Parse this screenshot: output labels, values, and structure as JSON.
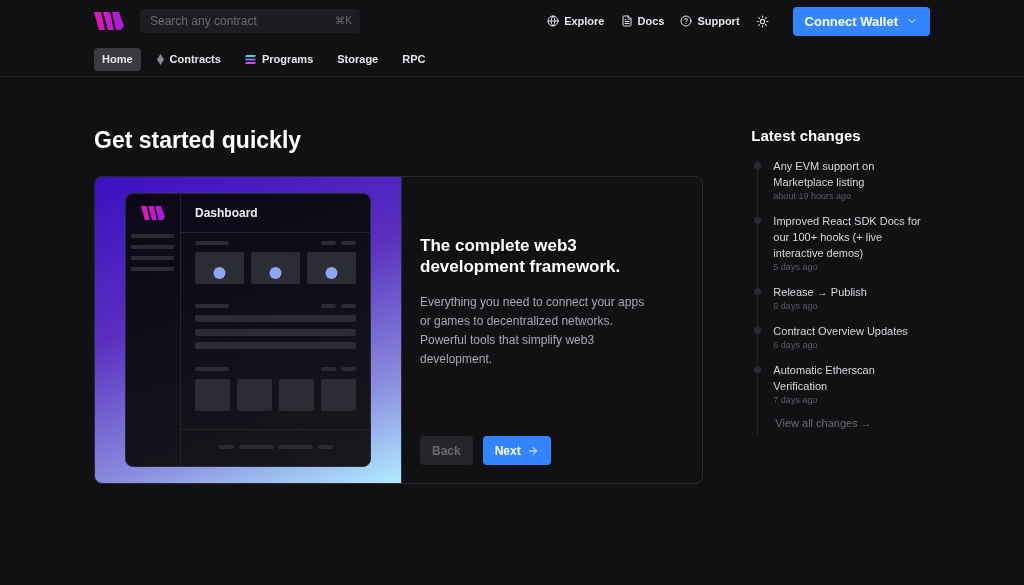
{
  "search": {
    "placeholder": "Search any contract",
    "shortcut": "⌘K"
  },
  "header_links": [
    {
      "kind": "globe",
      "label": "Explore"
    },
    {
      "kind": "doc",
      "label": "Docs"
    },
    {
      "kind": "help",
      "label": "Support"
    }
  ],
  "connect_button": "Connect Wallet",
  "tabs": [
    {
      "label": "Home",
      "kind": "plain",
      "selected": true
    },
    {
      "label": "Contracts",
      "kind": "diamond",
      "selected": false
    },
    {
      "label": "Programs",
      "kind": "stack",
      "selected": false
    },
    {
      "label": "Storage",
      "kind": "plain",
      "selected": false
    },
    {
      "label": "RPC",
      "kind": "plain",
      "selected": false
    }
  ],
  "heading": "Get started quickly",
  "card": {
    "preview_title": "Dashboard",
    "title": "The complete web3 development framework.",
    "body": "Everything you need to connect your apps or games to decentralized networks. Powerful tools that simplify web3 development.",
    "back": {
      "label": "Back",
      "disabled": true
    },
    "next": {
      "label": "Next",
      "disabled": false
    }
  },
  "changes": {
    "title": "Latest changes",
    "items": [
      {
        "text": "Any EVM support on Marketplace listing",
        "time": "about 19 hours ago"
      },
      {
        "text": "Improved React SDK Docs for our 100+ hooks (+ live interactive demos)",
        "time": "5 days ago"
      },
      {
        "text": "Release → Publish",
        "time": "6 days ago"
      },
      {
        "text": "Contract Overview Updates",
        "time": "6 days ago"
      },
      {
        "text": "Automatic Etherscan Verification",
        "time": "7 days ago"
      }
    ],
    "view_all": "View all changes →"
  }
}
